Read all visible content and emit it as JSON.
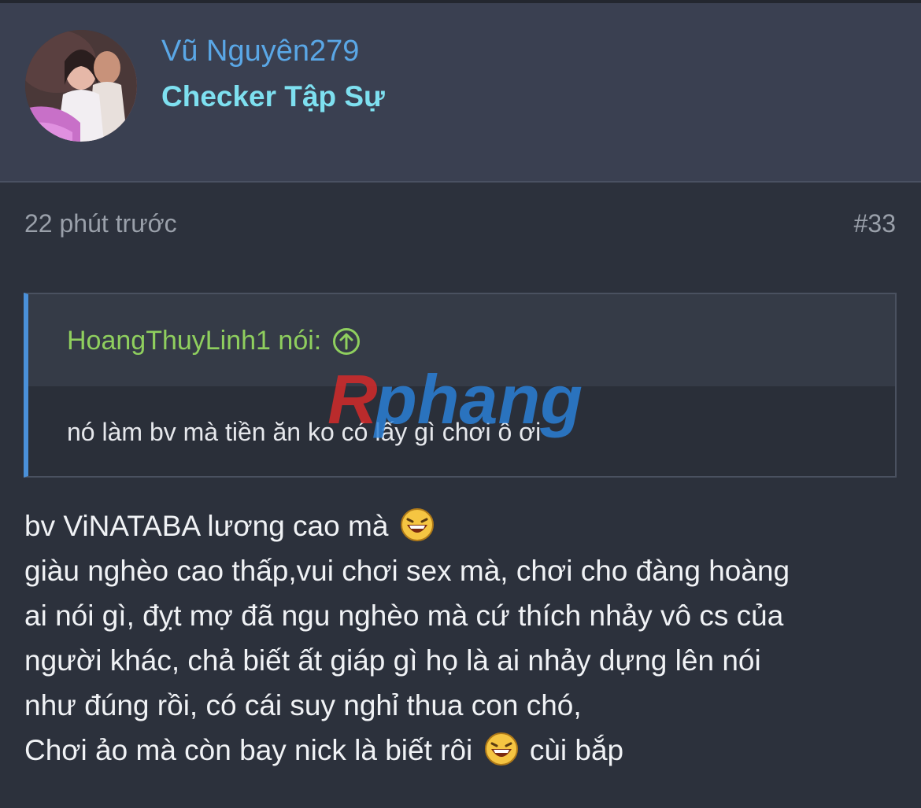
{
  "user": {
    "name": "Vũ Nguyên279",
    "title": "Checker Tập Sự"
  },
  "post": {
    "time": "22 phút trước",
    "number": "#33"
  },
  "quote": {
    "author": "HoangThuyLinh1 nói:",
    "text": "nó làm bv mà tiền ăn ko có lấy gì chơi ô ơi"
  },
  "watermark": "Rphang",
  "message": {
    "line1_a": "bv ViNATABA lương cao mà",
    "line2": "giàu nghèo cao thấp,vui chơi sex mà, chơi cho đàng hoàng",
    "line3": "ai nói gì, đỵt mợ đã ngu nghèo mà cứ thích nhảy vô cs của",
    "line4": "người khác, chả biết ất giáp gì họ là ai nhảy dựng lên nói",
    "line5": "như đúng rồi, có cái suy nghỉ thua con chó,",
    "line6_a": "Chơi ảo mà còn bay nick là biết rôi",
    "line6_b": "cùi bắp"
  },
  "colors": {
    "background": "#2c313c",
    "header": "#3a4051",
    "username": "#5aa7e6",
    "user_title": "#7ee0f0",
    "quote_author": "#8fcf5e",
    "quote_border": "#4a90d9"
  },
  "icons": {
    "quote_jump": "arrow-up-circle-icon",
    "emoji": "laughing-emoji-icon"
  }
}
